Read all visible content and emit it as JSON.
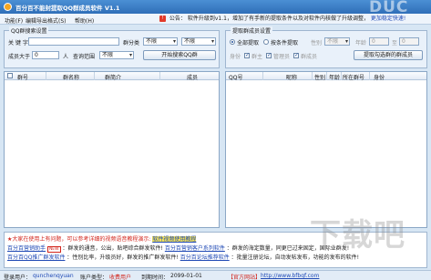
{
  "window": {
    "title": "百分百不能封提取QQ群成员软件  V1.1",
    "watermark": "DUC"
  },
  "menu": {
    "items": [
      "功能(F)",
      "编辑导出格式(S)",
      "帮助(H)"
    ]
  },
  "notice": {
    "prefix": "公告：",
    "text": "软件升级到v1.1，增加了有手新的提取条件以及对软件内核做了升级调整，",
    "link": "更加稳定快速!"
  },
  "search_group": {
    "legend": "QQ群搜索设置",
    "keyword_label": "关 键 字",
    "category_label": "群分类",
    "category_value_1": "不限",
    "category_value_2": "不限",
    "members_label": "成员大于",
    "members_value": "0",
    "members_unit": "人",
    "region_label": "查询范围",
    "region_value": "不限",
    "search_button": "开始搜索QQ群"
  },
  "extract_group": {
    "legend": "提取群成员设置",
    "radio_all": "全部提取",
    "radio_condition": "按条件提取",
    "gender_label": "性别",
    "gender_value": "不限",
    "age_label": "年龄",
    "age_from": "0",
    "age_to_label": "至",
    "age_to": "0",
    "identity_label": "身份",
    "check_owner": "群主",
    "check_admin": "管理员",
    "check_member": "群成员",
    "extract_button": "提取勾选群的群成员"
  },
  "left_table": {
    "columns": [
      "群号",
      "群名称",
      "群简介",
      "成员"
    ]
  },
  "right_table": {
    "columns": [
      "QQ号",
      "昵称",
      "性别",
      "年龄",
      "所在群号",
      "身份"
    ]
  },
  "bottom": {
    "line1_star": "★",
    "line1_text": "大家在使用上有问题，可以参考详细的视频语音教程演示:",
    "line1_link": "软件视频使用教程",
    "line2_a": "百分百营销助手",
    "line2_badge": "NEW",
    "line2_b": "：群发的通音，公出，贴吧综合群发软件!",
    "line2_c": "百分百营销客户系列软件",
    "line2_d": "：群发的海定数量，同更已过来固定，国际业群发!",
    "line3_a": "百分百QQ推广群发软件",
    "line3_b": "：性别比率，升级员好，群发的推广群发软件!",
    "line3_c": "百分百论坛推荐软件",
    "line3_d": "：批量注册论坛，自动发帖发布，功能的发布的软件!"
  },
  "status": {
    "user_label": "登录用户：",
    "user_value": "qunchenqyuan",
    "account_label": "账户类型：",
    "account_value": "收费用户",
    "expire_label": "到期时间：",
    "expire_value": "2099-01-01",
    "site_label": "【官方网站】",
    "site_value": "http://www.bfbqf.com"
  },
  "watermark_site": "下载吧"
}
